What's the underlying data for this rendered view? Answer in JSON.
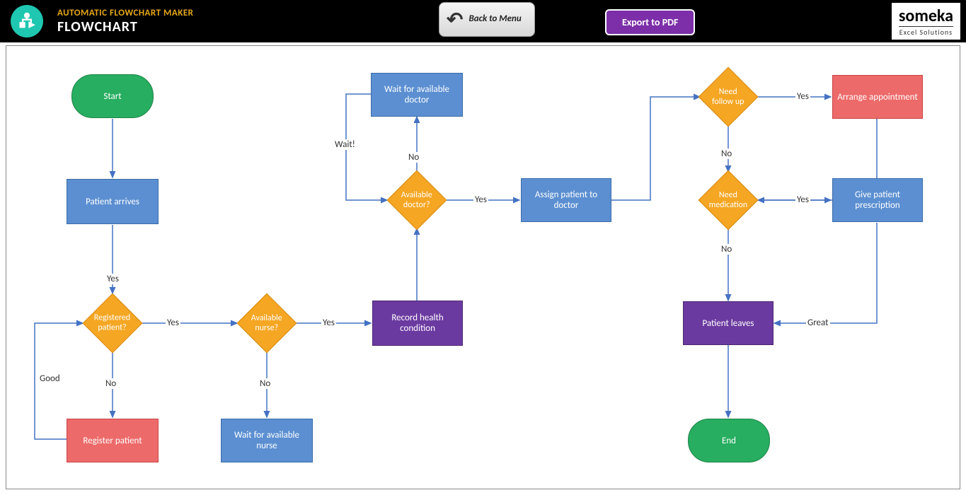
{
  "header": {
    "subtitle": "AUTOMATIC FLOWCHART MAKER",
    "title": "FLOWCHART",
    "back_button": "Back to Menu",
    "export_button": "Export to PDF",
    "brand_name": "someka",
    "brand_sub": "Excel Solutions"
  },
  "nodes": {
    "start": "Start",
    "patient_arrives": "Patient arrives",
    "registered_patient": "Registered patient?",
    "register_patient": "Register patient",
    "available_nurse": "Available nurse?",
    "wait_nurse": "Wait for available nurse",
    "record_health": "Record health condition",
    "available_doctor": "Available doctor?",
    "wait_doctor": "Wait for available doctor",
    "assign_patient": "Assign patient to doctor",
    "need_followup": "Need follow up",
    "arrange_appointment": "Arrange appointment",
    "need_medication": "Need medication",
    "give_prescription": "Give patient prescription",
    "patient_leaves": "Patient leaves",
    "end": "End"
  },
  "labels": {
    "yes": "Yes",
    "no": "No",
    "good": "Good",
    "wait": "Wait!",
    "great": "Great"
  }
}
